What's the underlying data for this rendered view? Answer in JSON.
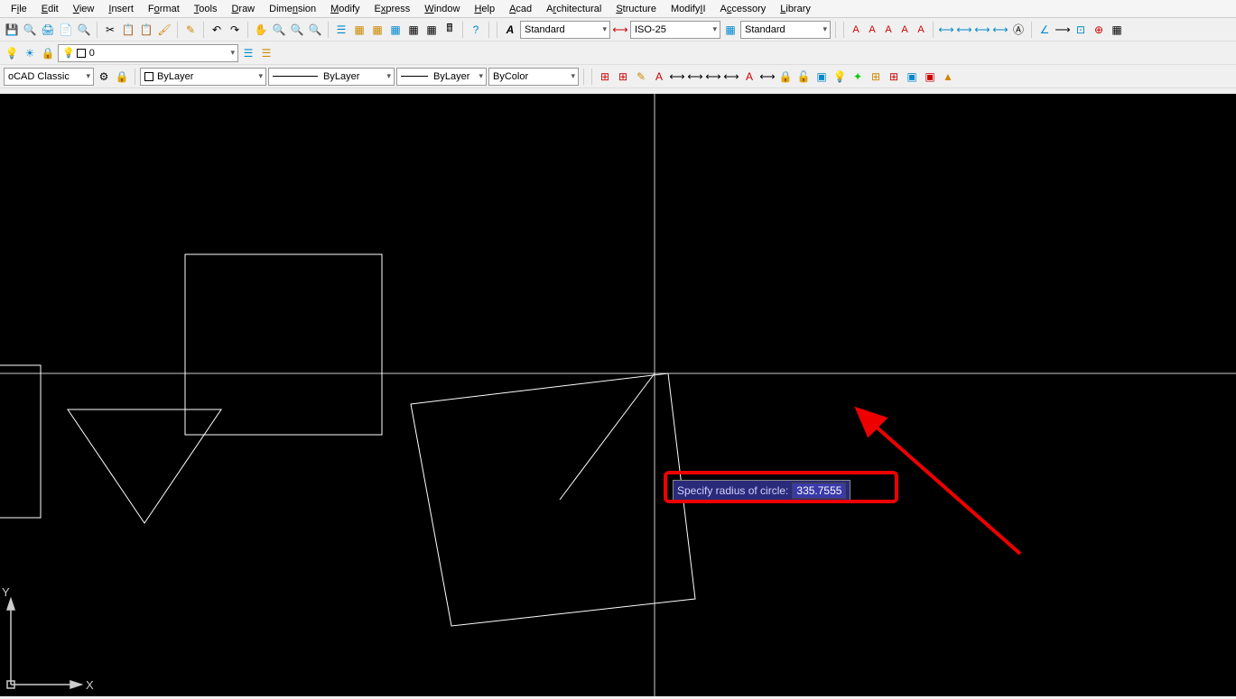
{
  "menu": {
    "items": [
      {
        "label": "File",
        "u": 1
      },
      {
        "label": "Edit",
        "u": 0
      },
      {
        "label": "View",
        "u": 0
      },
      {
        "label": "Insert",
        "u": 0
      },
      {
        "label": "Format",
        "u": 1
      },
      {
        "label": "Tools",
        "u": 0
      },
      {
        "label": "Draw",
        "u": 0
      },
      {
        "label": "Dimension",
        "u": 5
      },
      {
        "label": "Modify",
        "u": 0
      },
      {
        "label": "Express",
        "u": 0
      },
      {
        "label": "Window",
        "u": 0
      },
      {
        "label": "Help",
        "u": 0
      },
      {
        "label": "Acad",
        "u": 0
      },
      {
        "label": "Architectural",
        "u": 1
      },
      {
        "label": "Structure",
        "u": 0
      },
      {
        "label": "ModifyII",
        "u": 6
      },
      {
        "label": "Accessory",
        "u": 1
      },
      {
        "label": "Library",
        "u": 0
      }
    ]
  },
  "toolbar1": {
    "textStyle": "Standard",
    "dimStyle": "ISO-25",
    "tableStyle": "Standard"
  },
  "layerbar": {
    "current": "0"
  },
  "propbar": {
    "workspace": "oCAD Classic",
    "layerColor": "ByLayer",
    "linetype": "ByLayer",
    "lineweight": "ByLayer",
    "plotstyle": "ByColor"
  },
  "dynamicInput": {
    "prompt": "Specify radius of circle:",
    "value": "335.7555"
  },
  "axes": {
    "x": "X",
    "y": "Y"
  }
}
